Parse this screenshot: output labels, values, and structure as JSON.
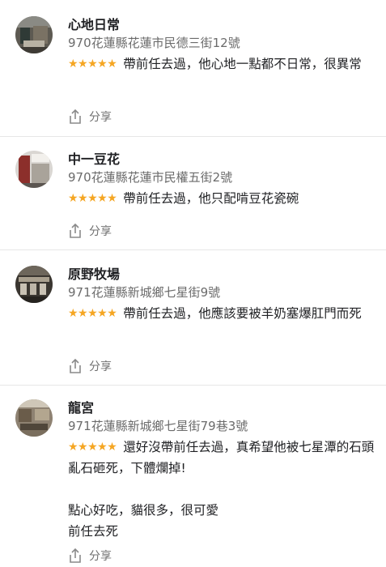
{
  "reviews": [
    {
      "name": "心地日常",
      "address": "970花蓮縣花蓮市民德三街12號",
      "rating": 5,
      "stars": "★★★★★",
      "text": "帶前任去過，他心地一點都不日常，很異常",
      "share_label": "分享"
    },
    {
      "name": "中一豆花",
      "address": "970花蓮縣花蓮市民權五街2號",
      "rating": 5,
      "stars": "★★★★★",
      "text": "帶前任去過，他只配啃豆花瓷碗",
      "share_label": "分享"
    },
    {
      "name": "原野牧場",
      "address": "971花蓮縣新城鄉七星街9號",
      "rating": 5,
      "stars": "★★★★★",
      "text": "帶前任去過，他應該要被羊奶塞爆肛門而死",
      "share_label": "分享"
    },
    {
      "name": "龍宮",
      "address": "971花蓮縣新城鄉七星街79巷3號",
      "rating": 5,
      "stars": "★★★★★",
      "text": "還好沒帶前任去過，真希望他被七星潭的石頭亂石砸死，下體爛掉!\n\n點心好吃，貓很多，很可愛\n前任去死",
      "share_label": "分享"
    }
  ],
  "icons": {
    "share": "share-icon"
  },
  "colors": {
    "stars": "#f5a623",
    "divider": "#e6e6e6",
    "secondary_text": "#6b6b6b"
  }
}
